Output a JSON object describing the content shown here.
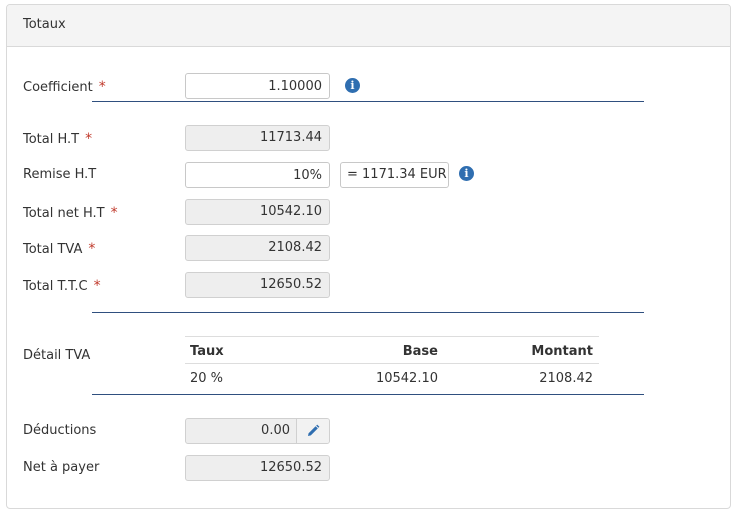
{
  "panel": {
    "title": "Totaux"
  },
  "required_mark": "*",
  "coefficient": {
    "label": "Coefficient",
    "value": "1.10000"
  },
  "total_ht": {
    "label": "Total H.T",
    "value": "11713.44"
  },
  "remise_ht": {
    "label": "Remise H.T",
    "value": "10%",
    "amount": "= 1171.34 EUR"
  },
  "total_net_ht": {
    "label": "Total net H.T",
    "value": "10542.10"
  },
  "total_tva": {
    "label": "Total TVA",
    "value": "2108.42"
  },
  "total_ttc": {
    "label": "Total T.T.C",
    "value": "12650.52"
  },
  "detail_tva": {
    "label": "Détail TVA",
    "headers": {
      "taux": "Taux",
      "base": "Base",
      "montant": "Montant"
    },
    "rows": [
      {
        "taux": "20 %",
        "base": "10542.10",
        "montant": "2108.42"
      }
    ]
  },
  "deductions": {
    "label": "Déductions",
    "value": "0.00",
    "edit_icon": "pencil-icon"
  },
  "net_a_payer": {
    "label": "Net à payer",
    "value": "12650.52"
  },
  "icons": {
    "info": "info-icon"
  },
  "colors": {
    "accent": "#2f6eb0",
    "required": "#c0392b",
    "separator": "#2f4f7f",
    "readonly_bg": "#eeeeee"
  }
}
